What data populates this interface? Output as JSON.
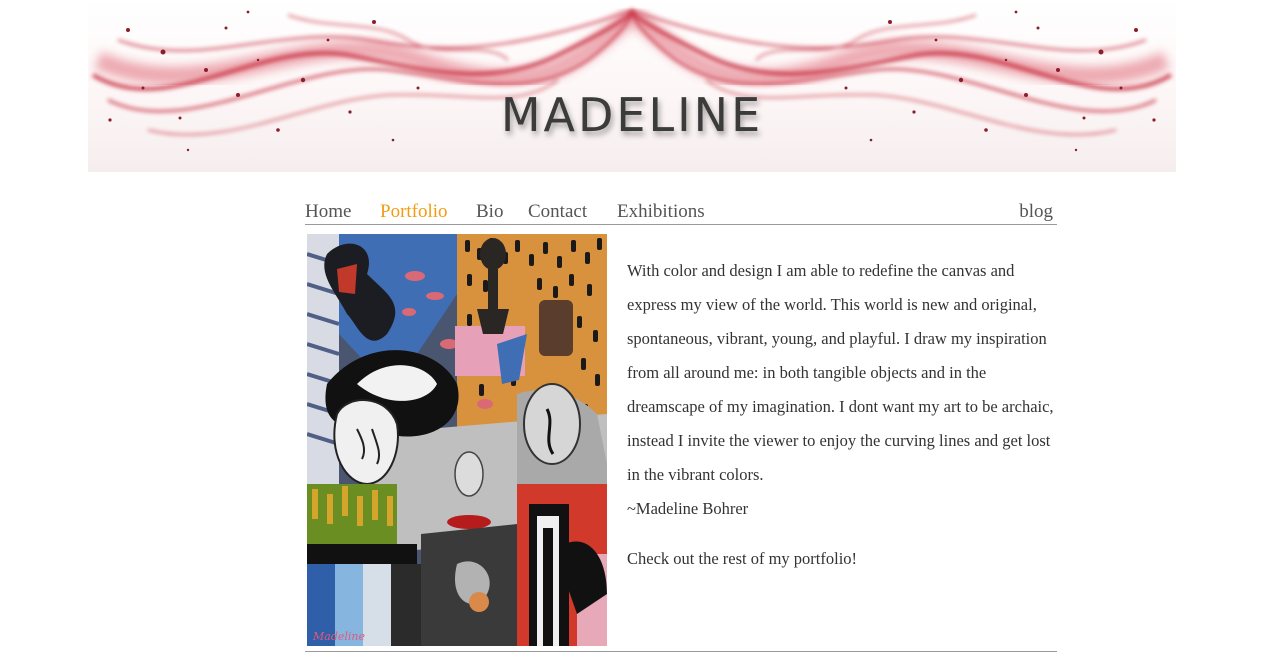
{
  "header": {
    "site_title": "MADELINE",
    "accent_color": "#c8323c"
  },
  "nav": {
    "items": [
      {
        "label": "Home",
        "active": false
      },
      {
        "label": "Portfolio",
        "active": true
      },
      {
        "label": "Bio",
        "active": false
      },
      {
        "label": "Contact",
        "active": false
      },
      {
        "label": "Exhibitions",
        "active": false
      }
    ],
    "blog_label": "blog",
    "active_color": "#f39c12"
  },
  "main": {
    "painting_signature": "Madeline",
    "statement": "With color and design I am able to redefine the canvas and express my view of the world. This world is new and original, spontaneous, vibrant, young, and playful. I draw my inspiration from all around me: in both tangible objects and in the dreamscape of my imagination. I dont want my art to be archaic, instead I invite the viewer to enjoy the curving lines and get lost in the vibrant colors.",
    "signature": "~Madeline Bohrer",
    "cta": "Check out the rest of my portfolio!"
  }
}
